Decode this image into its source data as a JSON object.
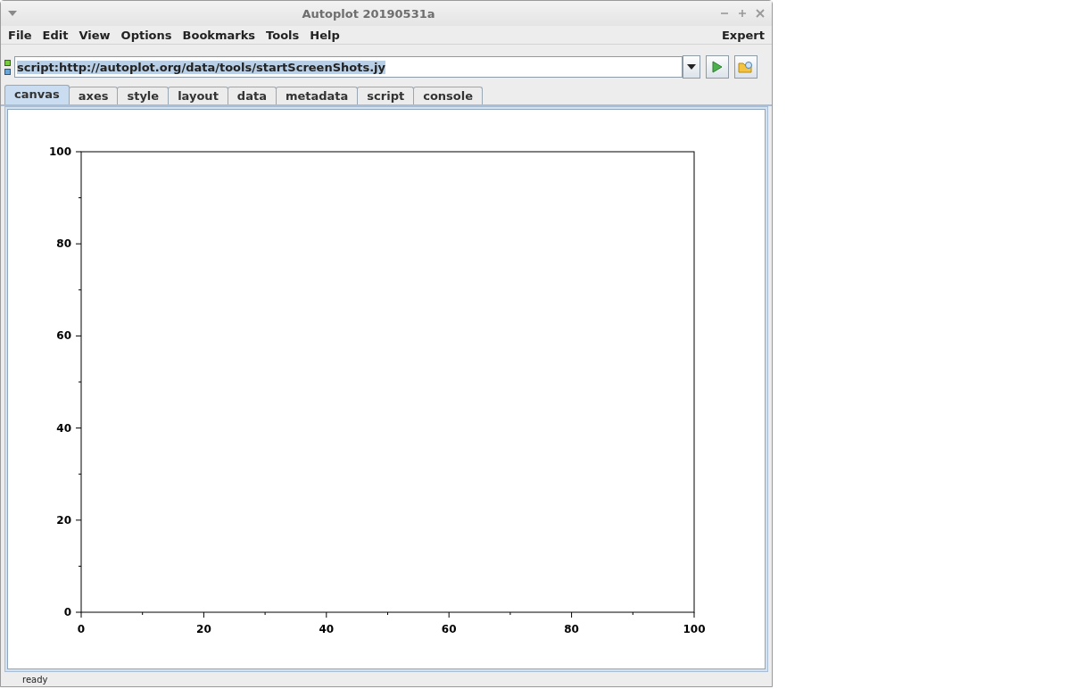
{
  "window": {
    "title": "Autoplot 20190531a"
  },
  "menu": [
    {
      "label": "File"
    },
    {
      "label": "Edit"
    },
    {
      "label": "View"
    },
    {
      "label": "Options"
    },
    {
      "label": "Bookmarks"
    },
    {
      "label": "Tools"
    },
    {
      "label": "Help"
    }
  ],
  "menu_right": {
    "label": "Expert"
  },
  "address": {
    "value": "script:http://autoplot.org/data/tools/startScreenShots.jy",
    "selected": true
  },
  "tabs": [
    {
      "label": "canvas",
      "selected": true
    },
    {
      "label": "axes",
      "selected": false
    },
    {
      "label": "style",
      "selected": false
    },
    {
      "label": "layout",
      "selected": false
    },
    {
      "label": "data",
      "selected": false
    },
    {
      "label": "metadata",
      "selected": false
    },
    {
      "label": "script",
      "selected": false
    },
    {
      "label": "console",
      "selected": false
    }
  ],
  "plot": {
    "chart_data": {
      "type": "line",
      "xlim": [
        0,
        100
      ],
      "ylim": [
        0,
        100
      ],
      "xticks": [
        0,
        20,
        40,
        60,
        80,
        100
      ],
      "yticks": [
        0,
        20,
        40,
        60,
        80,
        100
      ]
    }
  },
  "status_bar": {
    "text": "ready"
  }
}
